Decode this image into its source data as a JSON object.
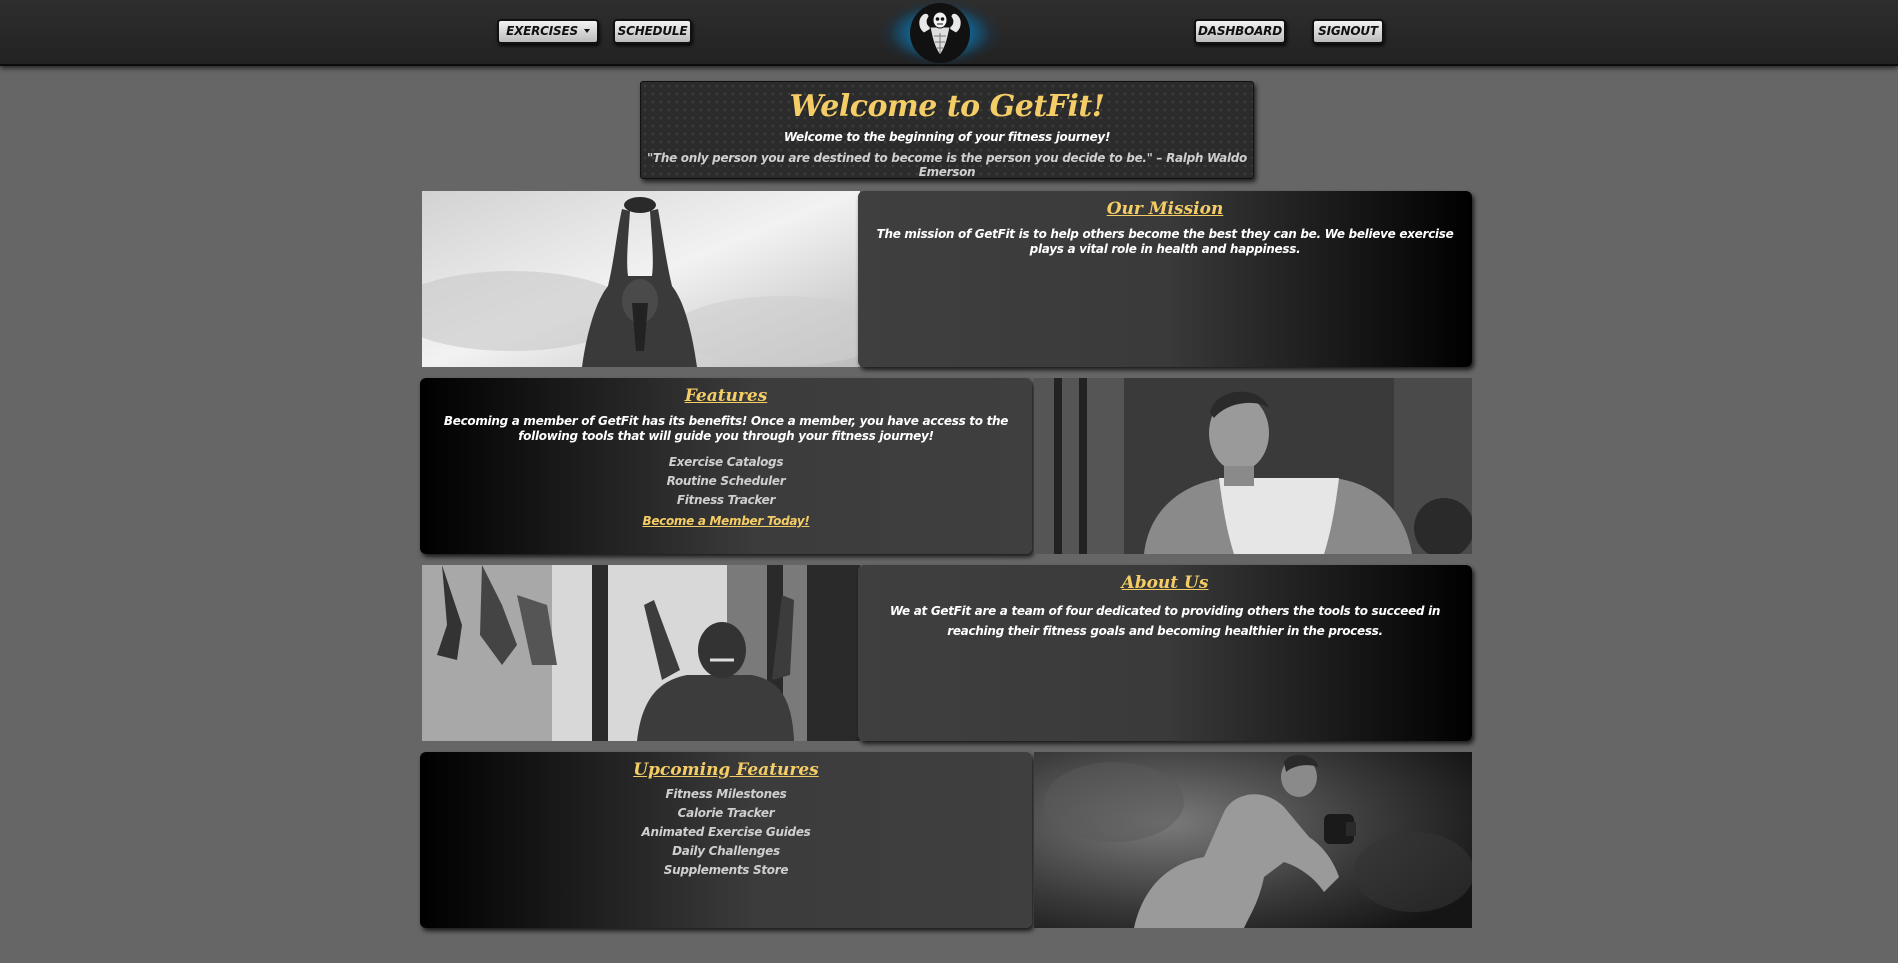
{
  "nav": {
    "exercises_label": "EXERCISES",
    "schedule_label": "SCHEDULE",
    "dashboard_label": "DASHBOARD",
    "signout_label": "SIGNOUT",
    "logo_icon": "bodybuilder-skull-logo-icon"
  },
  "welcome": {
    "title": "Welcome to GetFit!",
    "subtitle": "Welcome to the beginning of your fitness journey!",
    "quote": "\"The only person you are destined to become is the person you decide to be.\" – Ralph Waldo Emerson"
  },
  "mission": {
    "heading": "Our Mission",
    "text": "The mission of GetFit is to help others become the best they can be. We believe exercise plays a vital role in health and happiness."
  },
  "features": {
    "heading": "Features",
    "text": "Becoming a member of GetFit has its benefits! Once a member, you have access to the following tools that will guide you through your fitness journey!",
    "items": [
      "Exercise Catalogs",
      "Routine Scheduler",
      "Fitness Tracker"
    ],
    "cta": "Become a Member Today!"
  },
  "about": {
    "heading": "About Us",
    "text": "We at GetFit are a team of four dedicated to providing others the tools to succeed in reaching their fitness goals and becoming healthier in the process."
  },
  "upcoming": {
    "heading": "Upcoming Features",
    "items": [
      "Fitness Milestones",
      "Calorie Tracker",
      "Animated Exercise Guides",
      "Daily Challenges",
      "Supplements Store"
    ]
  },
  "colors": {
    "accent": "#f5cd66",
    "page_bg": "#666666",
    "nav_bg": "#2a2a2a",
    "logo_glow": "#1b8fc4"
  }
}
